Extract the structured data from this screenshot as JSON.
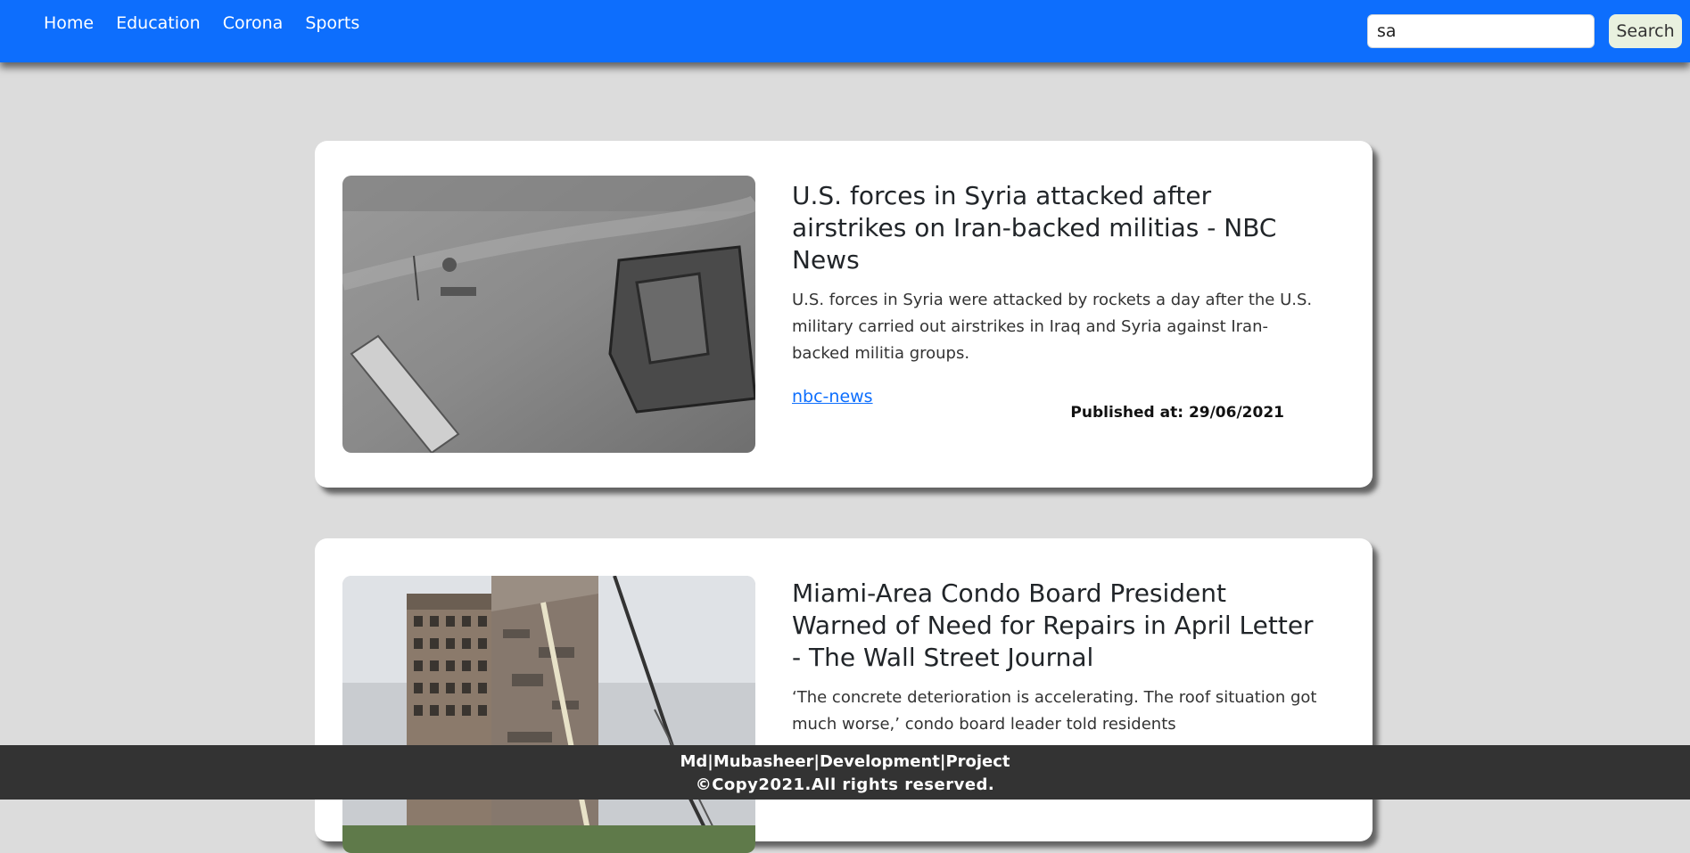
{
  "nav": {
    "links": [
      "Home",
      "Education",
      "Corona",
      "Sports"
    ]
  },
  "search": {
    "value": "sa",
    "button_label": "Search"
  },
  "articles": [
    {
      "title": "U.S. forces in Syria attacked after airstrikes on Iran-backed militias - NBC News",
      "description": "U.S. forces in Syria were attacked by rockets a day after the U.S. military carried out airstrikes in Iraq and Syria against Iran-backed militia groups.",
      "source": "nbc-news",
      "published": "Published at: 29/06/2021"
    },
    {
      "title": "Miami-Area Condo Board President Warned of Need for Repairs in April Letter - The Wall Street Journal",
      "description": "‘The concrete deterioration is accelerating. The roof situation got much worse,’ condo board leader told residents"
    }
  ],
  "footer": {
    "line1": "Md|Mubasheer|Development|Project",
    "line2": "©Copy2021.All rights reserved."
  },
  "colors": {
    "navbar": "#0d6efd",
    "background": "#dcdcdc",
    "footer": "#333333",
    "link": "#0d6efd"
  }
}
